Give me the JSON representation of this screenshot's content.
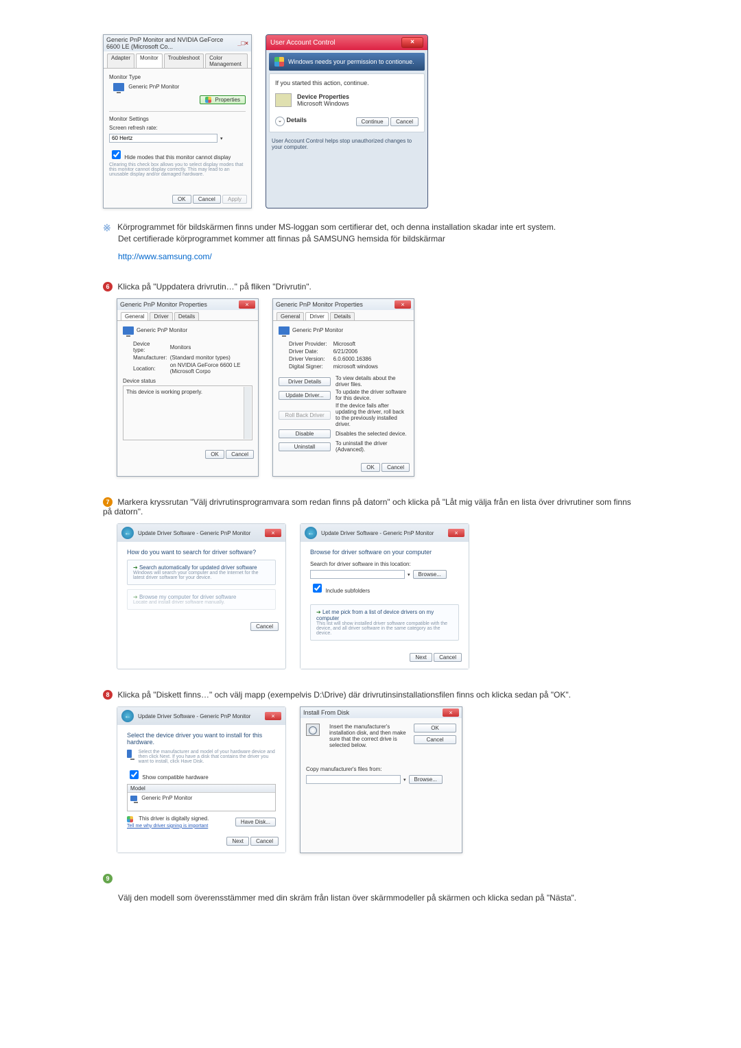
{
  "shot1": {
    "title": "Generic PnP Monitor and NVIDIA GeForce 6600 LE (Microsoft Co...",
    "tabs": [
      "Adapter",
      "Monitor",
      "Troubleshoot",
      "Color Management"
    ],
    "section_monitor_type": "Monitor Type",
    "monitor_name": "Generic PnP Monitor",
    "properties_btn": "Properties",
    "section_monitor_settings": "Monitor Settings",
    "refresh_label": "Screen refresh rate:",
    "refresh_value": "60 Hertz",
    "hide_modes_checkbox": "Hide modes that this monitor cannot display",
    "hide_modes_desc": "Clearing this check box allows you to select display modes that this monitor cannot display correctly. This may lead to an unusable display and/or damaged hardware.",
    "ok": "OK",
    "cancel": "Cancel",
    "apply": "Apply"
  },
  "uac": {
    "title": "User Account Control",
    "headline": "Windows needs your permission to contionue.",
    "started": "If you started this action, continue.",
    "prog_name": "Device Properties",
    "prog_pub": "Microsoft Windows",
    "details": "Details",
    "continue": "Continue",
    "cancel": "Cancel",
    "footer": "User Account Control helps stop unauthorized changes to your computer."
  },
  "note": {
    "line1": "Körprogrammet för bildskärmen finns under MS-loggan som certifierar det, och denna installation skadar inte ert system.",
    "line2": "Det certifierade körprogrammet kommer att finnas på SAMSUNG hemsida för bildskärmar",
    "url": "http://www.samsung.com/"
  },
  "step6_text": "Klicka på \"Uppdatera drivrutin…\" på fliken \"Drivrutin\".",
  "props_general": {
    "title": "Generic PnP Monitor Properties",
    "tabs": [
      "General",
      "Driver",
      "Details"
    ],
    "name": "Generic PnP Monitor",
    "rows": {
      "device_type_l": "Device type:",
      "device_type_v": "Monitors",
      "manufacturer_l": "Manufacturer:",
      "manufacturer_v": "(Standard monitor types)",
      "location_l": "Location:",
      "location_v": "on NVIDIA GeForce 6600 LE (Microsoft Corpo"
    },
    "status_label": "Device status",
    "status_text": "This device is working properly.",
    "ok": "OK",
    "cancel": "Cancel"
  },
  "props_driver": {
    "title": "Generic PnP Monitor Properties",
    "tabs": [
      "General",
      "Driver",
      "Details"
    ],
    "name": "Generic PnP Monitor",
    "rows": {
      "provider_l": "Driver Provider:",
      "provider_v": "Microsoft",
      "date_l": "Driver Date:",
      "date_v": "6/21/2006",
      "version_l": "Driver Version:",
      "version_v": "6.0.6000.16386",
      "signer_l": "Digital Signer:",
      "signer_v": "microsoft windows"
    },
    "btns": {
      "details": "Driver Details",
      "details_d": "To view details about the driver files.",
      "update": "Update Driver...",
      "update_d": "To update the driver software for this device.",
      "rollback": "Roll Back Driver",
      "rollback_d": "If the device fails after updating the driver, roll back to the previously installed driver.",
      "disable": "Disable",
      "disable_d": "Disables the selected device.",
      "uninstall": "Uninstall",
      "uninstall_d": "To uninstall the driver (Advanced)."
    },
    "ok": "OK",
    "cancel": "Cancel"
  },
  "step7_text": "Markera kryssrutan \"Välj drivrutinsprogramvara som redan finns på datorn\" och klicka på \"Låt mig välja från en lista över drivrutiner som finns på datorn\".",
  "wiz1": {
    "title": "Update Driver Software - Generic PnP Monitor",
    "question": "How do you want to search for driver software?",
    "opt1": "Search automatically for updated driver software",
    "opt1_sub": "Windows will search your computer and the Internet for the latest driver software for your device.",
    "opt2": "Browse my computer for driver software",
    "opt2_sub": "Locate and install driver software manually.",
    "cancel": "Cancel"
  },
  "wiz2": {
    "title": "Update Driver Software - Generic PnP Monitor",
    "heading": "Browse for driver software on your computer",
    "search_label": "Search for driver software in this location:",
    "browse": "Browse...",
    "include_sub": "Include subfolders",
    "opt": "Let me pick from a list of device drivers on my computer",
    "opt_sub": "This list will show installed driver software compatible with the device, and all driver software in the same category as the device.",
    "next": "Next",
    "cancel": "Cancel"
  },
  "step8_text": "Klicka på \"Diskett finns…\" och välj mapp (exempelvis D:\\Drive) där drivrutinsinstallationsfilen finns och klicka sedan på \"OK\".",
  "wiz3": {
    "title": "Update Driver Software - Generic PnP Monitor",
    "heading": "Select the device driver you want to install for this hardware.",
    "sub": "Select the manufacturer and model of your hardware device and then click Next. If you have a disk that contains the driver you want to install, click Have Disk.",
    "show_compat": "Show compatible hardware",
    "model": "Model",
    "item": "Generic PnP Monitor",
    "signed": "This driver is digitally signed.",
    "tell_me": "Tell me why driver signing is important",
    "have_disk": "Have Disk...",
    "next": "Next",
    "cancel": "Cancel"
  },
  "install_disk": {
    "title": "Install From Disk",
    "msg": "Insert the manufacturer's installation disk, and then make sure that the correct drive is selected below.",
    "ok": "OK",
    "cancel": "Cancel",
    "copy_label": "Copy manufacturer's files from:",
    "browse": "Browse..."
  },
  "step9_text": "Välj den modell som överensstämmer med din skräm från listan över skärmmodeller på skärmen och klicka sedan på \"Nästa\"."
}
